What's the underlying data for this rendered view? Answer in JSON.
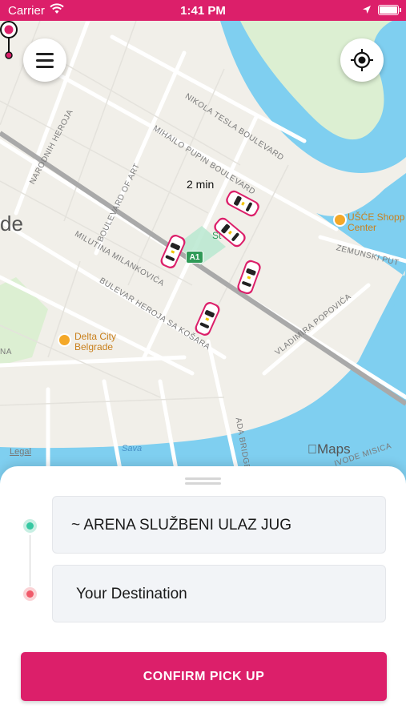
{
  "status_bar": {
    "carrier": "Carrier",
    "time": "1:41 PM"
  },
  "map": {
    "city": "de",
    "streets": [
      "NIKOLA TESLA BOULEVARD",
      "MIHAILO PUPIN BOULEVARD",
      "NARODNIH HEROJA",
      "BOULEVARD OF ART",
      "MILUTINA MILANKOVIĆA",
      "BULEVAR HEROJA SA KOŠARA",
      "VLADIMIRA POPOVIĆA",
      "ZEMUNSKI PUT",
      "ADA BRIDGE",
      "IVODE MISICA",
      "NA"
    ],
    "pois": {
      "usce_line1": "UŠĆE Shopp",
      "usce_line2": "Center",
      "delta_line1": "Delta City",
      "delta_line2": "Belgrade"
    },
    "station": "St  ena",
    "highway_badge": "A1",
    "water": "Sava",
    "legal": "Legal",
    "brand": "Maps",
    "eta": "2 min"
  },
  "booking": {
    "pickup": "~ ARENA SLUŽBENI ULAZ JUG",
    "destination": "Your Destination",
    "confirm_label": "CONFIRM PICK UP"
  },
  "colors": {
    "brand": "#dc1f6a",
    "pickup_dot": "#36c8a2",
    "destination_dot": "#f05a6a",
    "water": "#7fcff0",
    "park": "#dcefd2"
  }
}
